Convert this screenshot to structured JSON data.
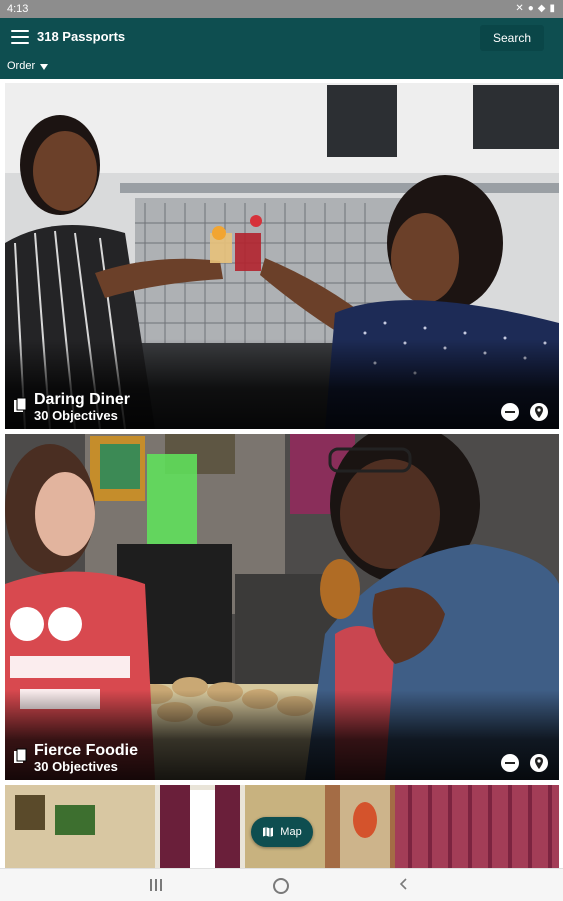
{
  "status_bar": {
    "time": "4:13"
  },
  "header": {
    "title": "318 Passports",
    "search_label": "Search",
    "order_label": "Order"
  },
  "cards": [
    {
      "title": "Daring Diner",
      "subtitle": "30 Objectives"
    },
    {
      "title": "Fierce Foodie",
      "subtitle": "30 Objectives"
    },
    {
      "title": "",
      "subtitle": ""
    }
  ],
  "map_button": {
    "label": "Map"
  },
  "colors": {
    "brand": "#0e4e50",
    "status_bar": "#8d8d8d"
  },
  "icons": {
    "menu": "hamburger-icon",
    "passport": "passport-icon",
    "remove": "minus-circle-icon",
    "location": "location-pin-icon",
    "map": "map-icon"
  }
}
